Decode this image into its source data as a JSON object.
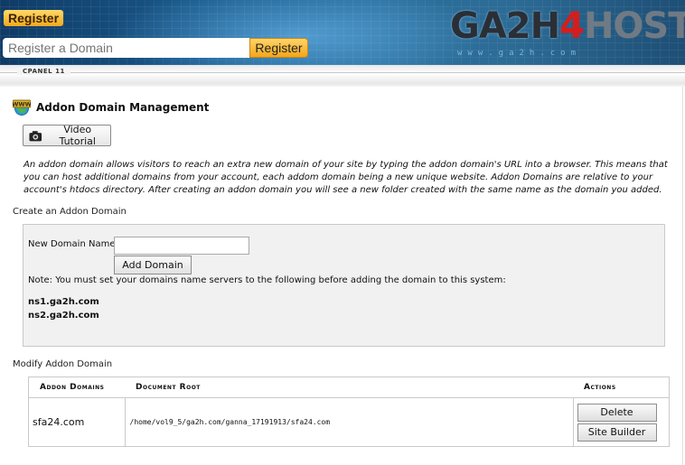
{
  "header": {
    "register_badge": "Register",
    "search_placeholder": "Register a Domain",
    "register_button": "Register",
    "logo_part1": "GA2H",
    "logo_part2": "4",
    "logo_part3": "HOST",
    "logo_url": "www.ga2h.com"
  },
  "cpanel": {
    "label": "CPANEL 11"
  },
  "page": {
    "title": "Addon Domain Management",
    "video_tutorial": "Video Tutorial",
    "description": "An addon domain allows visitors to reach an extra new domain of your site by typing the addon domain's URL into a browser. This means that you can host additional domains from your account, each addom domain being a new unique website. Addon Domains are relative to your account's htdocs directory. After creating an addon domain you will see a new folder created with the same name as the domain you added."
  },
  "create": {
    "section_label": "Create an Addon Domain",
    "new_domain_label": "New Domain Name:",
    "new_domain_value": "",
    "add_button": "Add Domain",
    "note": "Note: You must set your domains name servers to the following before adding the domain to this system:",
    "nameservers": [
      "ns1.ga2h.com",
      "ns2.ga2h.com"
    ]
  },
  "modify": {
    "section_label": "Modify Addon Domain",
    "columns": [
      "Addon Domains",
      "Document Root",
      "Actions"
    ],
    "rows": [
      {
        "domain": "sfa24.com",
        "root": "/home/vol9_5/ga2h.com/ganna_17191913/sfa24.com",
        "actions": [
          "Delete",
          "Site Builder"
        ]
      }
    ]
  },
  "icons": {
    "www": "www-globe-icon",
    "camera": "camera-icon"
  }
}
